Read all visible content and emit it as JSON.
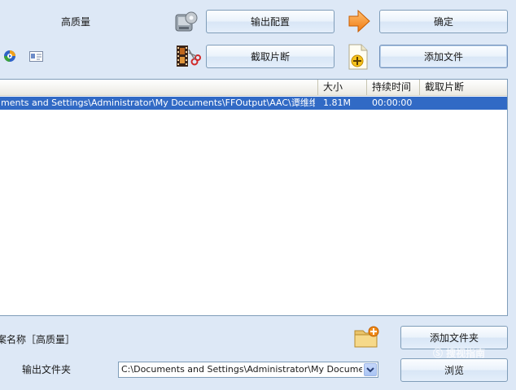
{
  "top": {
    "quality_label": "高质量",
    "output_config_button": "输出配置",
    "ok_button": "确定",
    "clip_button": "截取片断",
    "add_file_button": "添加文件"
  },
  "list": {
    "columns": [
      "大小",
      "持续时间",
      "截取片断"
    ],
    "rows": [
      {
        "path": "ments and Settings\\Administrator\\My Documents\\FFOutput\\AAC\\谭维维&钟...",
        "size": "1.81M",
        "duration": "00:00:00",
        "clip": ""
      }
    ]
  },
  "bottom": {
    "profile_name": "案名称［高质量］",
    "add_folder_button": "添加文件夹",
    "output_folder_label": "输出文件夹",
    "output_folder_value": "C:\\Documents and Settings\\Administrator\\My Documents\\FFOutput",
    "browse_button": "浏览",
    "watermark": "Ⓢ 搜视指南"
  },
  "colors": {
    "background": "#dde8f6",
    "selection": "#316ac5",
    "border": "#7f9db9"
  }
}
